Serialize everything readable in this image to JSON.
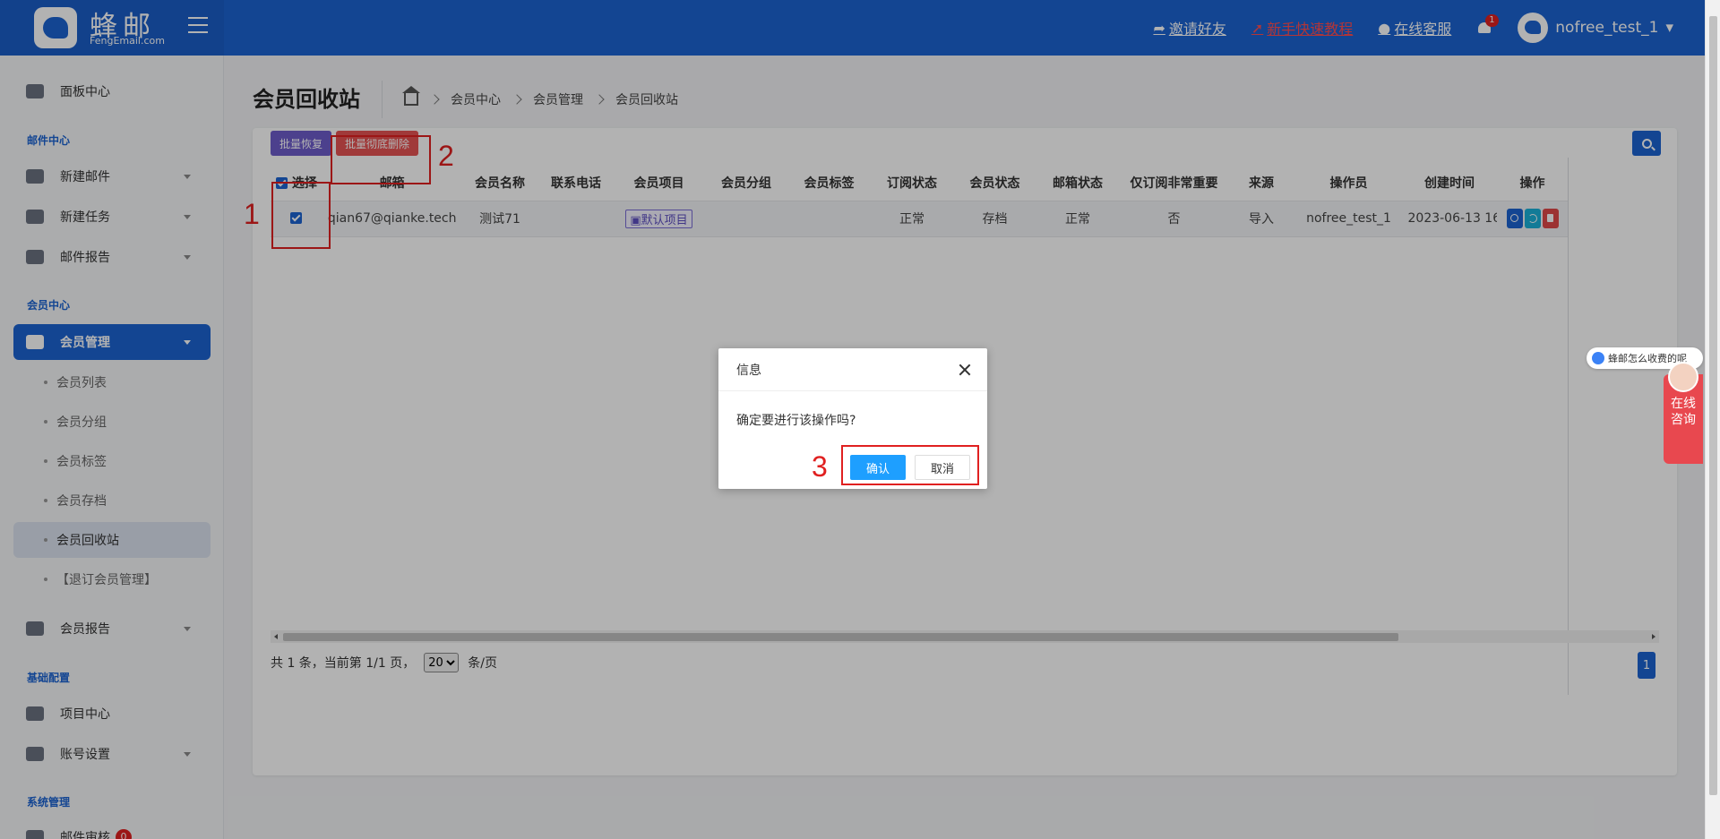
{
  "header": {
    "logo_text": "蜂邮",
    "logo_sub": "FengEmail.com",
    "invite": "邀请好友",
    "tutorial": "新手快速教程",
    "support": "在线客服",
    "notif_count": "1",
    "username": "nofree_test_1"
  },
  "sidebar": {
    "dashboard": "面板中心",
    "group_mail": "邮件中心",
    "new_mail": "新建邮件",
    "new_task": "新建任务",
    "mail_report": "邮件报告",
    "group_member": "会员中心",
    "member_mgmt": "会员管理",
    "sub_items": [
      "会员列表",
      "会员分组",
      "会员标签",
      "会员存档",
      "会员回收站",
      "【退订会员管理】"
    ],
    "member_report": "会员报告",
    "group_base": "基础配置",
    "project_center": "项目中心",
    "account_settings": "账号设置",
    "group_system": "系统管理",
    "mail_audit": "邮件审核",
    "mail_audit_badge": "0"
  },
  "page": {
    "title": "会员回收站",
    "breadcrumb": [
      "会员中心",
      "会员管理",
      "会员回收站"
    ]
  },
  "toolbar": {
    "restore_label": "批量恢复",
    "delete_label": "批量彻底删除"
  },
  "table": {
    "headers": [
      "选择",
      "邮箱",
      "会员名称",
      "联系电话",
      "会员项目",
      "会员分组",
      "会员标签",
      "订阅状态",
      "会员状态",
      "邮箱状态",
      "仅订阅非常重要",
      "来源",
      "操作员",
      "创建时间",
      "操作"
    ],
    "rows": [
      {
        "email": "qian67@qianke.tech",
        "name": "测试71",
        "phone": "",
        "project": "默认项目",
        "group": "",
        "tag": "",
        "subscribe": "正常",
        "member_status": "存档",
        "email_status": "正常",
        "important_only": "否",
        "source": "导入",
        "operator": "nofree_test_1",
        "created": "2023-06-13 16"
      }
    ]
  },
  "pager": {
    "summary": "共 1 条，当前第 1/1 页，",
    "page_size": "20",
    "per_page": "条/页",
    "current_page": "1"
  },
  "annotations": [
    "1",
    "2",
    "3"
  ],
  "dialog": {
    "title": "信息",
    "message": "确定要进行该操作吗?",
    "ok": "确认",
    "cancel": "取消"
  },
  "widgets": {
    "chat_bubble": "蜂邮怎么收费的呢",
    "consult_line1": "在线",
    "consult_line2": "咨询"
  },
  "colors": {
    "primary": "#1c64d2",
    "danger": "#e55353",
    "restore": "#6d5ccb",
    "dialog_ok": "#1e9fff",
    "annotation": "#e02020"
  }
}
